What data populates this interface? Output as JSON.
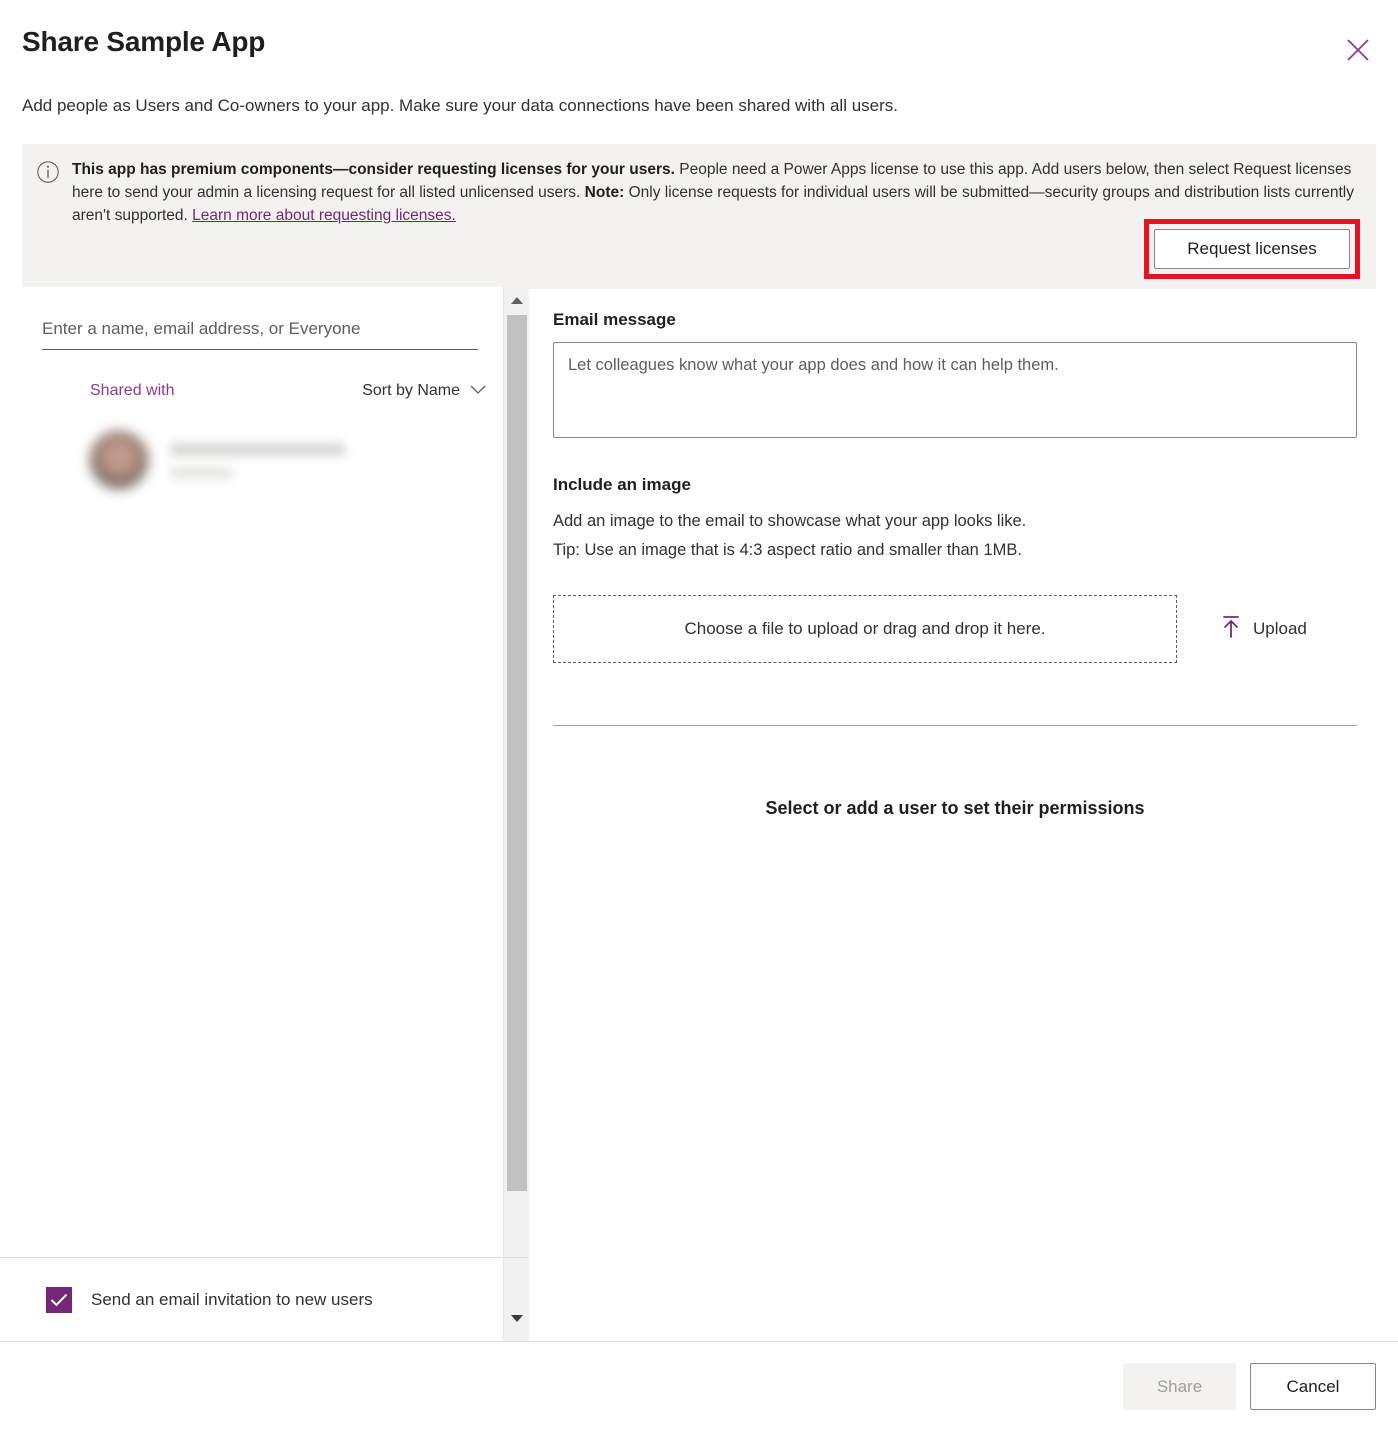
{
  "dialog": {
    "title": "Share Sample App",
    "subtitle": "Add people as Users and Co-owners to your app. Make sure your data connections have been shared with all users.",
    "close_icon": "close-icon"
  },
  "banner": {
    "icon": "info-icon",
    "bold_lead": "This app has premium components—consider requesting licenses for your users.",
    "text_1": " People need a Power Apps license to use this app. Add users below, then select Request licenses here to send your admin a licensing request for all listed unlicensed users. ",
    "bold_note": "Note:",
    "text_2": " Only license requests for individual users will be submitted—security groups and distribution lists currently aren't supported. ",
    "link_text": "Learn more about requesting licenses.",
    "request_licenses_label": "Request licenses",
    "highlight_color": "#e81123",
    "background": "#f3f2f1"
  },
  "left_panel": {
    "people_input_placeholder": "Enter a name, email address, or Everyone",
    "people_input_value": "",
    "shared_with_label": "Shared with",
    "sort_label": "Sort by Name",
    "sort_chevron_icon": "chevron-down-icon",
    "shared_users": [
      {
        "name": "",
        "role": "",
        "redacted": true
      }
    ],
    "send_email_label": "Send an email invitation to new users",
    "send_email_checked": true,
    "checkbox_color": "#742774",
    "scrollbar": {
      "up_icon": "scroll-up-arrow-icon",
      "down_icon": "scroll-down-arrow-icon"
    }
  },
  "right_panel": {
    "email_message_title": "Email message",
    "email_message_placeholder": "Let colleagues know what your app does and how it can help them.",
    "email_message_value": "",
    "include_image_title": "Include an image",
    "include_image_line_1": "Add an image to the email to showcase what your app looks like.",
    "include_image_line_2": "Tip: Use an image that is 4:3 aspect ratio and smaller than 1MB.",
    "dropzone_label": "Choose a file to upload or drag and drop it here.",
    "upload_label": "Upload",
    "upload_icon": "upload-arrow-icon",
    "permissions_empty_label": "Select or add a user to set their permissions"
  },
  "footer": {
    "share_label": "Share",
    "share_disabled": true,
    "cancel_label": "Cancel"
  },
  "theme": {
    "accent": "#742774",
    "link": "#742774",
    "shared_with": "#8e3a8e"
  }
}
